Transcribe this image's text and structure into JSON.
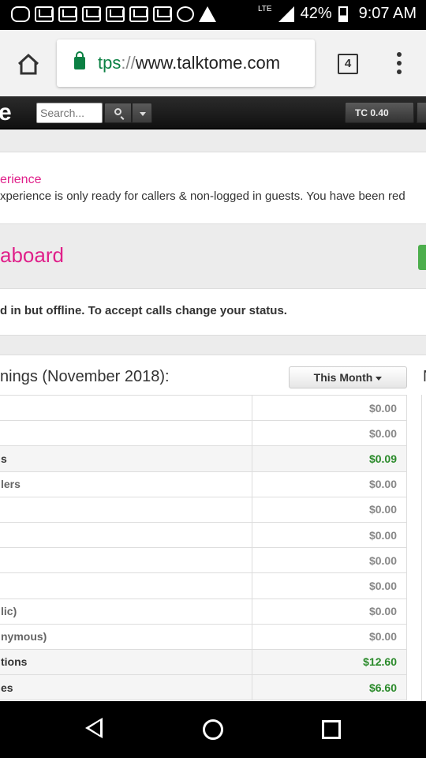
{
  "status_bar": {
    "battery": "42%",
    "time": "9:07 AM",
    "network": "LTE"
  },
  "browser": {
    "url_scheme": "tps",
    "url_sep": "://",
    "url_host": "www.talktome.com",
    "tab_count": "4",
    "icons": [
      "home-icon",
      "lock-icon",
      "tabs-icon",
      "overflow-menu-icon"
    ]
  },
  "site": {
    "logo_fragment": "e",
    "search_placeholder": "Search...",
    "tc_label": "TC 0.40"
  },
  "notice": {
    "title": "erience",
    "text": "xperience is only ready for callers & non-logged in guests. You have been red"
  },
  "dashboard": {
    "title": "aboard",
    "status_message": "d in but offline. To accept calls change your status."
  },
  "earnings": {
    "title": "nings (November 2018):",
    "filter_label": "This Month",
    "side_fragment": "N",
    "rows": [
      {
        "label": "",
        "value": "$0.00"
      },
      {
        "label": "",
        "value": "$0.00"
      },
      {
        "label": "s",
        "value": "$0.09"
      },
      {
        "label": "lers",
        "value": "$0.00"
      },
      {
        "label": "",
        "value": "$0.00"
      },
      {
        "label": "",
        "value": "$0.00"
      },
      {
        "label": "",
        "value": "$0.00"
      },
      {
        "label": "",
        "value": "$0.00"
      },
      {
        "label": "lic)",
        "value": "$0.00"
      },
      {
        "label": "nymous)",
        "value": "$0.00"
      },
      {
        "label": "tions",
        "value": "$12.60"
      },
      {
        "label": "es",
        "value": "$6.60"
      }
    ]
  },
  "colors": {
    "accent_pink": "#e0208a",
    "positive_green": "#2a8a2a",
    "secure_green": "#0b8043"
  }
}
